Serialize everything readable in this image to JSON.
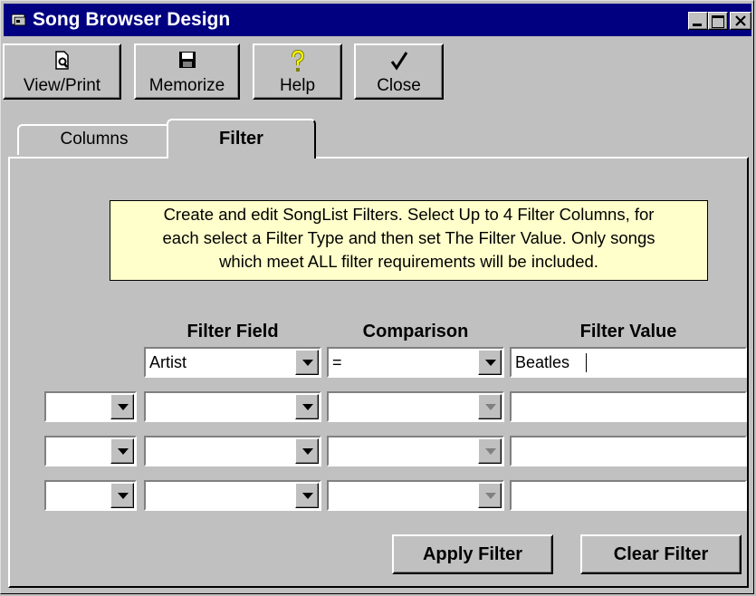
{
  "window": {
    "title": "Song Browser Design"
  },
  "toolbar": {
    "view_print": "View/Print",
    "memorize": "Memorize",
    "help": "Help",
    "close": "Close"
  },
  "tabs": {
    "columns": "Columns",
    "filter": "Filter",
    "active": "Filter"
  },
  "info": {
    "line1": "Create and edit SongList  Filters. Select Up to 4 Filter Columns, for",
    "line2": "each select a Filter Type and then set The Filter Value. Only songs",
    "line3": "which meet ALL filter requirements will be included."
  },
  "headers": {
    "field": "Filter Field",
    "comparison": "Comparison",
    "value": "Filter Value"
  },
  "rows": [
    {
      "field": "Artist",
      "comparison": "=",
      "value": "Beatles"
    },
    {
      "conjunction": "",
      "field": "",
      "comparison": "",
      "value": ""
    },
    {
      "conjunction": "",
      "field": "",
      "comparison": "",
      "value": ""
    },
    {
      "conjunction": "",
      "field": "",
      "comparison": "",
      "value": ""
    }
  ],
  "buttons": {
    "apply": "Apply Filter",
    "clear": "Clear Filter"
  },
  "colors": {
    "titlebar": "#000080",
    "face": "#c0c0c0",
    "info_bg": "#ffffcc"
  }
}
